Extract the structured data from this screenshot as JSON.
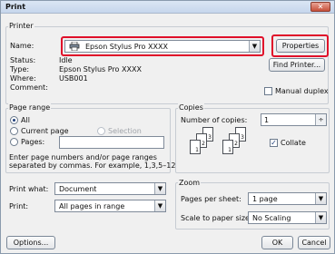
{
  "window": {
    "title": "Print",
    "close": "✕"
  },
  "printer": {
    "group_label": "Printer",
    "name_label": "Name:",
    "name_value": "Epson Stylus Pro XXXX",
    "properties_button": "Properties",
    "status_label": "Status:",
    "status_value": "Idle",
    "type_label": "Type:",
    "type_value": "Epson Stylus Pro XXXX",
    "where_label": "Where:",
    "where_value": "USB001",
    "comment_label": "Comment:",
    "comment_value": "",
    "find_printer_button": "Find Printer...",
    "manual_duplex_label": "Manual duplex",
    "manual_duplex_checked": false
  },
  "page_range": {
    "group_label": "Page range",
    "all_label": "All",
    "current_page_label": "Current page",
    "selection_label": "Selection",
    "pages_label": "Pages:",
    "pages_value": "",
    "selected": "all",
    "hint_line1": "Enter page numbers and/or page ranges",
    "hint_line2": "separated by commas. For example, 1,3,5–12"
  },
  "copies": {
    "group_label": "Copies",
    "number_label": "Number of copies:",
    "number_value": "1",
    "collate_label": "Collate",
    "collate_checked": true,
    "page_labels": [
      "3",
      "2",
      "1",
      "3",
      "2",
      "1"
    ]
  },
  "print_what": {
    "label": "Print what:",
    "value": "Document"
  },
  "print": {
    "label": "Print:",
    "value": "All pages in range"
  },
  "zoom": {
    "group_label": "Zoom",
    "pages_per_sheet_label": "Pages per sheet:",
    "pages_per_sheet_value": "1 page",
    "scale_label": "Scale to paper size:",
    "scale_value": "No Scaling"
  },
  "footer": {
    "options_button": "Options...",
    "ok_button": "OK",
    "cancel_button": "Cancel"
  },
  "colors": {
    "highlight": "#e0102a",
    "title_bar": "#c6d6ec"
  },
  "icons": {
    "printer": "printer-icon",
    "dropdown": "chevron-down-icon",
    "spinner": "spinner-icon"
  }
}
